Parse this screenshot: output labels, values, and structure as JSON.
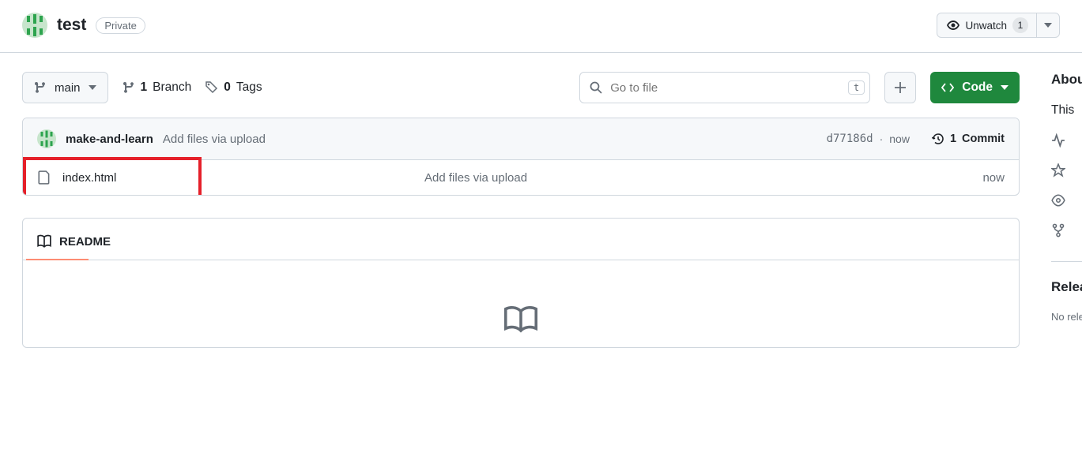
{
  "header": {
    "repo_name": "test",
    "visibility": "Private",
    "watch_label": "Unwatch",
    "watch_count": "1"
  },
  "toolbar": {
    "branch_name": "main",
    "branch_count": "1",
    "branch_label": "Branch",
    "tag_count": "0",
    "tag_label": "Tags",
    "search_placeholder": "Go to file",
    "search_kbd": "t",
    "code_label": "Code"
  },
  "commit": {
    "author": "make-and-learn",
    "message": "Add files via upload",
    "hash": "d77186d",
    "sep": "·",
    "time": "now",
    "count_num": "1",
    "count_label": "Commit"
  },
  "files": [
    {
      "name": "index.html",
      "message": "Add files via upload",
      "time": "now"
    }
  ],
  "readme": {
    "tab_label": "README"
  },
  "sidebar": {
    "about_heading": "About",
    "about_text": "This",
    "releases_heading": "Releases",
    "releases_text": "No releases"
  }
}
